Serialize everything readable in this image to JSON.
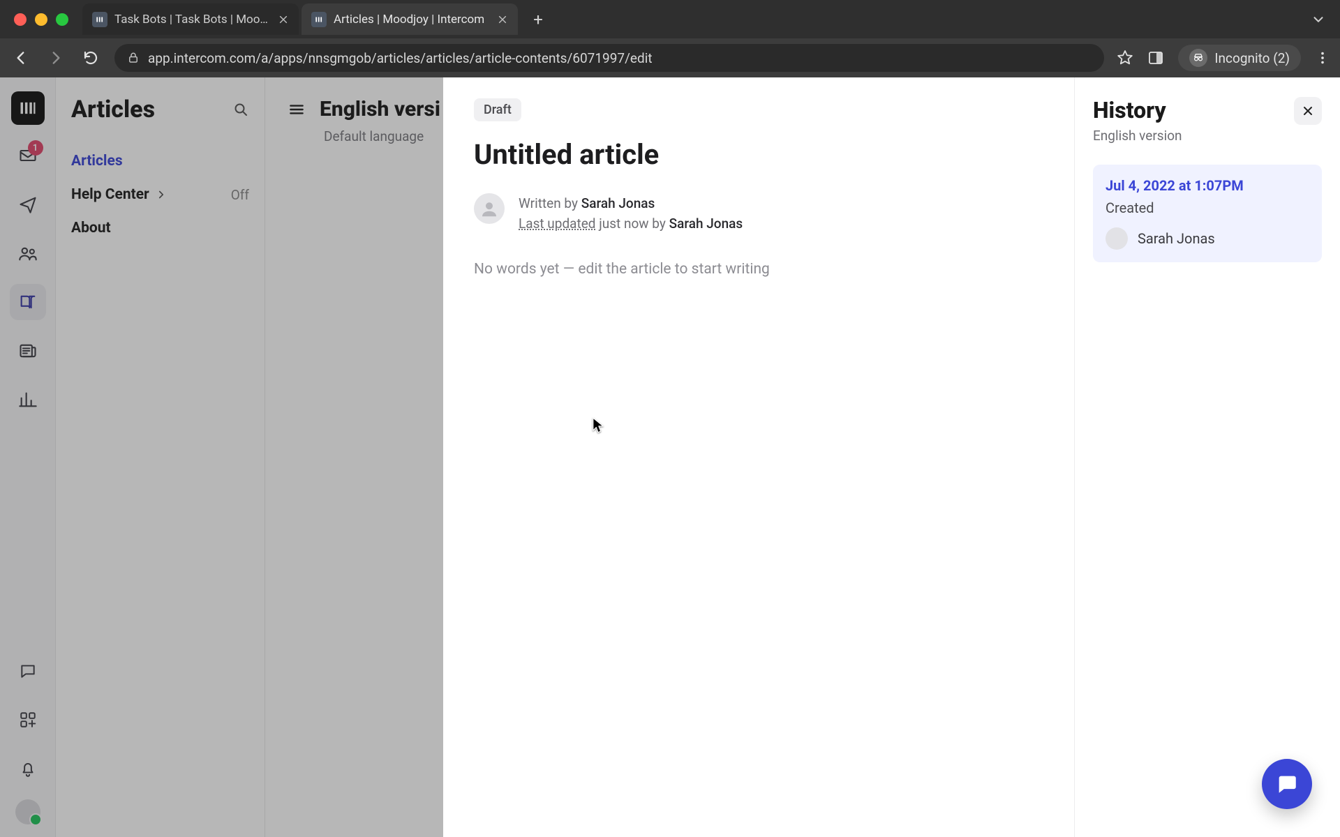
{
  "browser": {
    "tabs": [
      {
        "title": "Task Bots | Task Bots | Moodjo",
        "active": false
      },
      {
        "title": "Articles | Moodjoy | Intercom",
        "active": true
      }
    ],
    "url": "app.intercom.com/a/apps/nnsgmgob/articles/articles/article-contents/6071997/edit",
    "incognito_label": "Incognito (2)"
  },
  "rail": {
    "inbox_badge": "1"
  },
  "sidebar": {
    "title": "Articles",
    "items": [
      {
        "label": "Articles",
        "selected": true
      },
      {
        "label": "Help Center",
        "status": "Off",
        "chevron": true
      },
      {
        "label": "About"
      }
    ]
  },
  "main_bg": {
    "title": "English versi",
    "subtitle": "Default language"
  },
  "article": {
    "status_chip": "Draft",
    "title": "Untitled article",
    "written_by_prefix": "Written by ",
    "written_by_name": "Sarah Jonas",
    "last_updated_label": "Last updated",
    "last_updated_rest": " just now by ",
    "last_updated_name": "Sarah Jonas",
    "empty_text": "No words yet — edit the article to start writing"
  },
  "history": {
    "title": "History",
    "subtitle": "English version",
    "entry": {
      "date": "Jul 4, 2022 at 1:07PM",
      "kind": "Created",
      "user": "Sarah Jonas"
    }
  }
}
